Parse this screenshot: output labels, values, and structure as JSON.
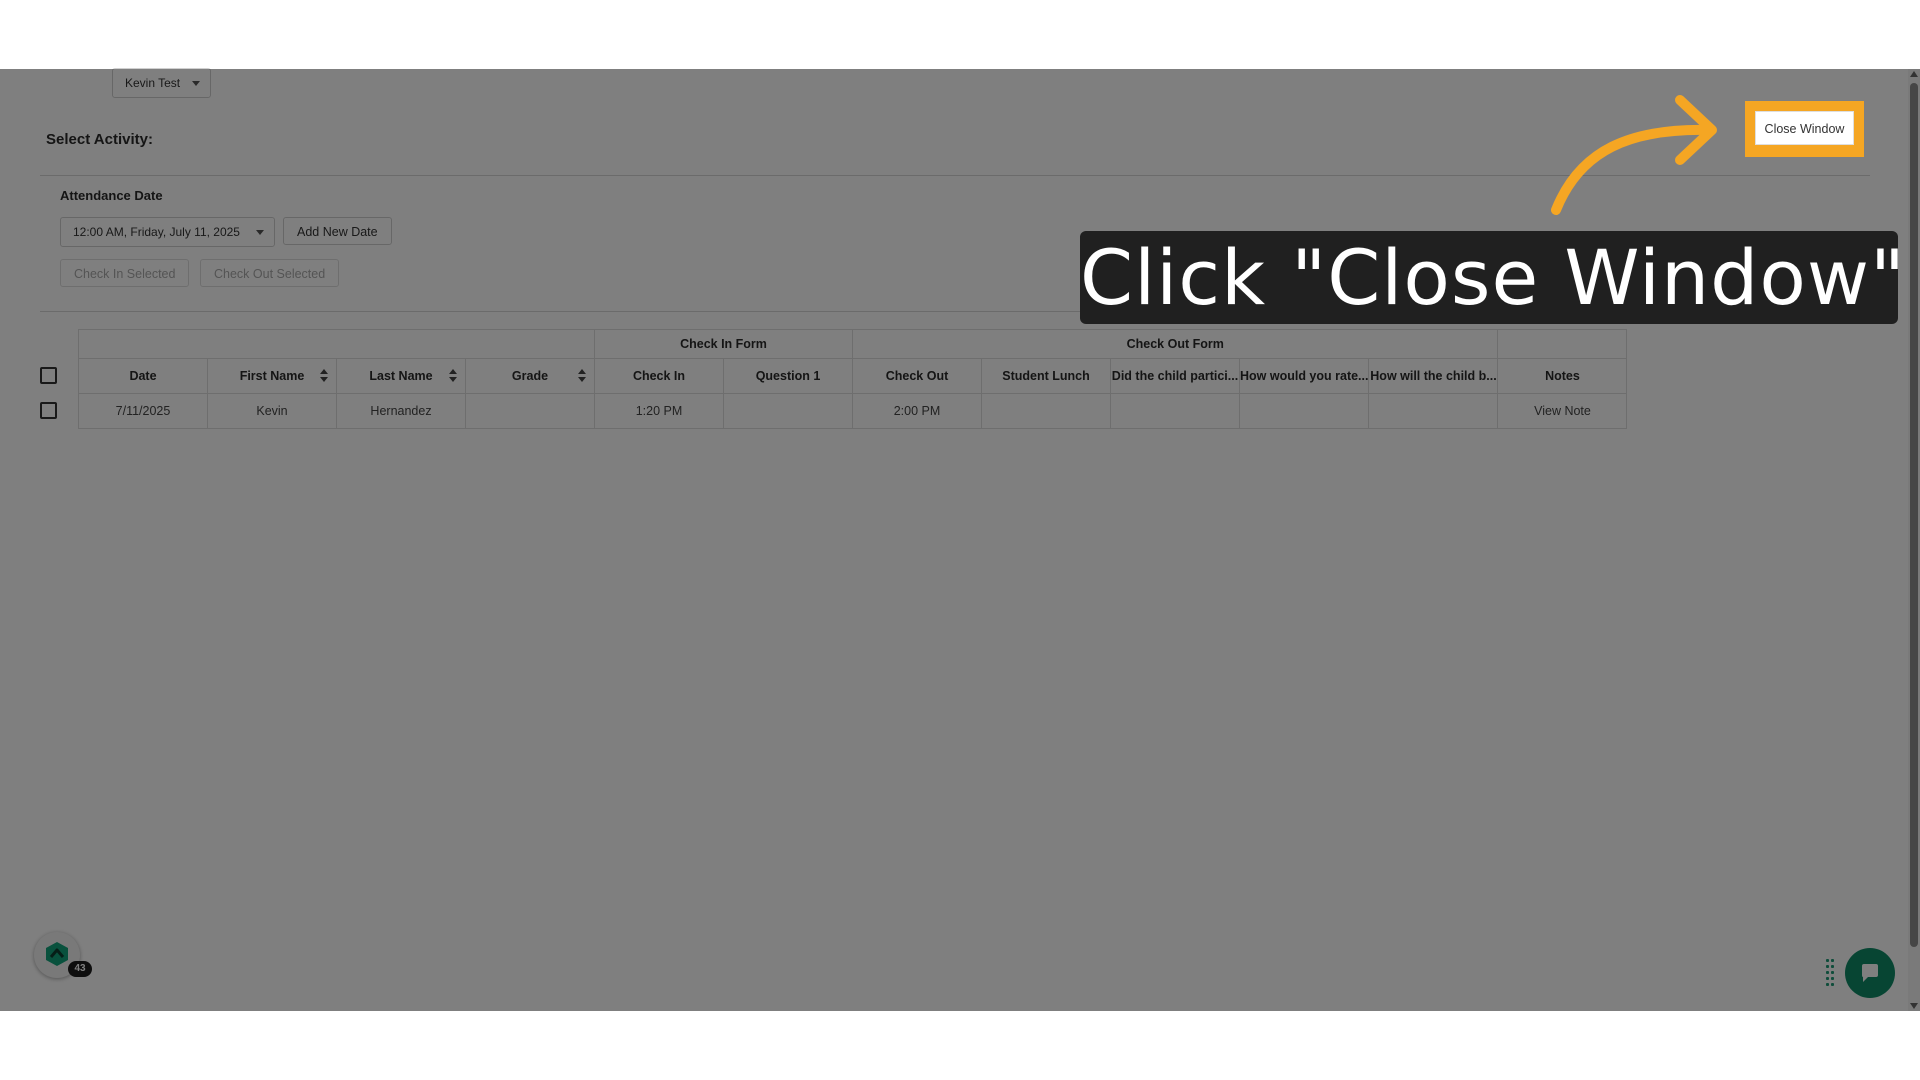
{
  "toolbar": {
    "select_activity_label": "Select Activity:",
    "activity_value": "Kevin Test",
    "close_window_label": "Close Window"
  },
  "attendance": {
    "label": "Attendance Date",
    "date_value": "12:00 AM, Friday, July 11, 2025",
    "add_new_date_label": "Add New Date",
    "check_in_selected_label": "Check In Selected",
    "check_out_selected_label": "Check Out Selected"
  },
  "table": {
    "groups": {
      "check_in_form": "Check In Form",
      "check_out_form": "Check Out Form"
    },
    "columns": [
      "Date",
      "First Name",
      "Last Name",
      "Grade",
      "Check In",
      "Question 1",
      "Check Out",
      "Student Lunch",
      "Did the child partici...",
      "How would you rate...",
      "How will the child b...",
      "Notes"
    ],
    "rows": [
      {
        "date": "7/11/2025",
        "first_name": "Kevin",
        "last_name": "Hernandez",
        "grade": "",
        "check_in": "1:20 PM",
        "question_1": "",
        "check_out": "2:00 PM",
        "student_lunch": "",
        "did_the_child": "",
        "how_would_you_rate": "",
        "how_will_the_child": "",
        "notes": "View Note"
      }
    ]
  },
  "widgets": {
    "notification_count": "43"
  },
  "tutorial": {
    "callout_text": "Click \"Close Window\"",
    "highlight_color": "#f5a623",
    "arrow_color": "#f5a623"
  },
  "icons": [
    "caret-down-icon",
    "sort-icon",
    "app-logo-icon",
    "chat-icon",
    "drag-handle-icon",
    "curved-arrow-icon"
  ]
}
